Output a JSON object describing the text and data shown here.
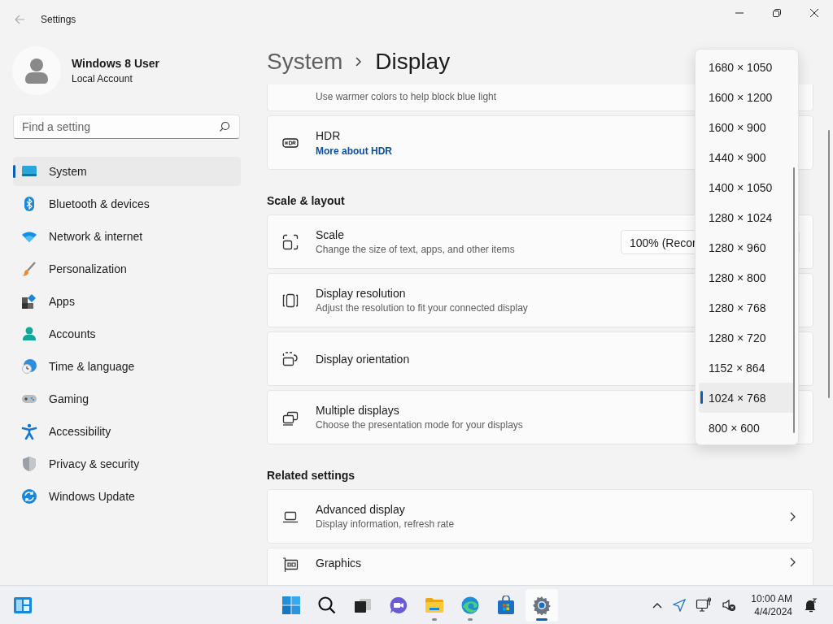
{
  "window": {
    "title": "Settings"
  },
  "account": {
    "name": "Windows 8 User",
    "type": "Local Account"
  },
  "search": {
    "placeholder": "Find a setting"
  },
  "sidebar": {
    "items": [
      {
        "label": "System",
        "selected": true
      },
      {
        "label": "Bluetooth & devices",
        "selected": false
      },
      {
        "label": "Network & internet",
        "selected": false
      },
      {
        "label": "Personalization",
        "selected": false
      },
      {
        "label": "Apps",
        "selected": false
      },
      {
        "label": "Accounts",
        "selected": false
      },
      {
        "label": "Time & language",
        "selected": false
      },
      {
        "label": "Gaming",
        "selected": false
      },
      {
        "label": "Accessibility",
        "selected": false
      },
      {
        "label": "Privacy & security",
        "selected": false
      },
      {
        "label": "Windows Update",
        "selected": false
      }
    ]
  },
  "breadcrumb": {
    "parent": "System",
    "current": "Display"
  },
  "sections": [
    {
      "cards": [
        {
          "description": "Use warmer colors to help block blue light"
        },
        {
          "title": "HDR",
          "link": "More about HDR"
        }
      ]
    },
    {
      "heading": "Scale & layout",
      "cards": [
        {
          "title": "Scale",
          "description": "Change the size of text, apps, and other items",
          "value": "100% (Recor"
        },
        {
          "title": "Display resolution",
          "description": "Adjust the resolution to fit your connected display"
        },
        {
          "title": "Display orientation"
        },
        {
          "title": "Multiple displays",
          "description": "Choose the presentation mode for your displays"
        }
      ]
    },
    {
      "heading": "Related settings",
      "cards": [
        {
          "title": "Advanced display",
          "description": "Display information, refresh rate",
          "chevron": true
        },
        {
          "title": "Graphics",
          "chevron": true
        }
      ]
    }
  ],
  "resolution_menu": {
    "options": [
      {
        "label": "1680 × 1050",
        "selected": false
      },
      {
        "label": "1600 × 1200",
        "selected": false
      },
      {
        "label": "1600 × 900",
        "selected": false
      },
      {
        "label": "1440 × 900",
        "selected": false
      },
      {
        "label": "1400 × 1050",
        "selected": false
      },
      {
        "label": "1280 × 1024",
        "selected": false
      },
      {
        "label": "1280 × 960",
        "selected": false
      },
      {
        "label": "1280 × 800",
        "selected": false
      },
      {
        "label": "1280 × 768",
        "selected": false
      },
      {
        "label": "1280 × 720",
        "selected": false
      },
      {
        "label": "1152 × 864",
        "selected": false
      },
      {
        "label": "1024 × 768",
        "selected": true
      },
      {
        "label": "800 × 600",
        "selected": false
      }
    ]
  },
  "taskbar": {
    "apps": [
      {
        "running": false,
        "selected": false
      },
      {
        "running": false,
        "selected": false
      },
      {
        "running": false,
        "selected": false
      },
      {
        "running": false,
        "selected": false
      },
      {
        "running": true,
        "selected": false
      },
      {
        "running": true,
        "selected": false
      },
      {
        "running": false,
        "selected": false
      },
      {
        "running": true,
        "selected": true
      }
    ],
    "time": "10:00 AM",
    "date": "4/4/2024"
  }
}
